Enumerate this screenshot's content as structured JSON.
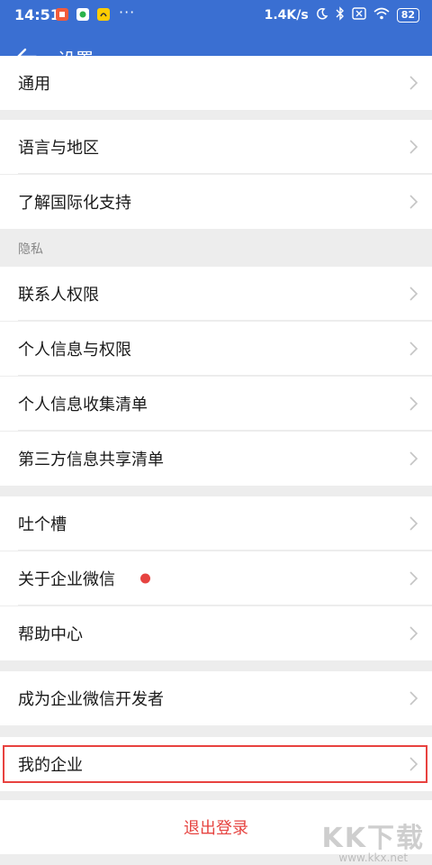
{
  "status_bar": {
    "time": "14:51",
    "network_speed": "1.4K/s",
    "battery": "82"
  },
  "toolbar": {
    "title": "设置"
  },
  "rows": {
    "general": "通用",
    "language_region": "语言与地区",
    "i18n_support": "了解国际化支持",
    "contacts_permission": "联系人权限",
    "personal_info_permission": "个人信息与权限",
    "personal_info_collection": "个人信息收集清单",
    "third_party_sharing": "第三方信息共享清单",
    "feedback": "吐个槽",
    "about": "关于企业微信",
    "help_center": "帮助中心",
    "become_developer": "成为企业微信开发者",
    "my_enterprise": "我的企业"
  },
  "sections": {
    "privacy": "隐私"
  },
  "logout": {
    "label": "退出登录"
  },
  "watermark": {
    "logo": "KK下载",
    "url": "www.kkx.net"
  },
  "colors": {
    "header": "#3a6fd2",
    "danger": "#e64340",
    "background": "#ededed"
  }
}
